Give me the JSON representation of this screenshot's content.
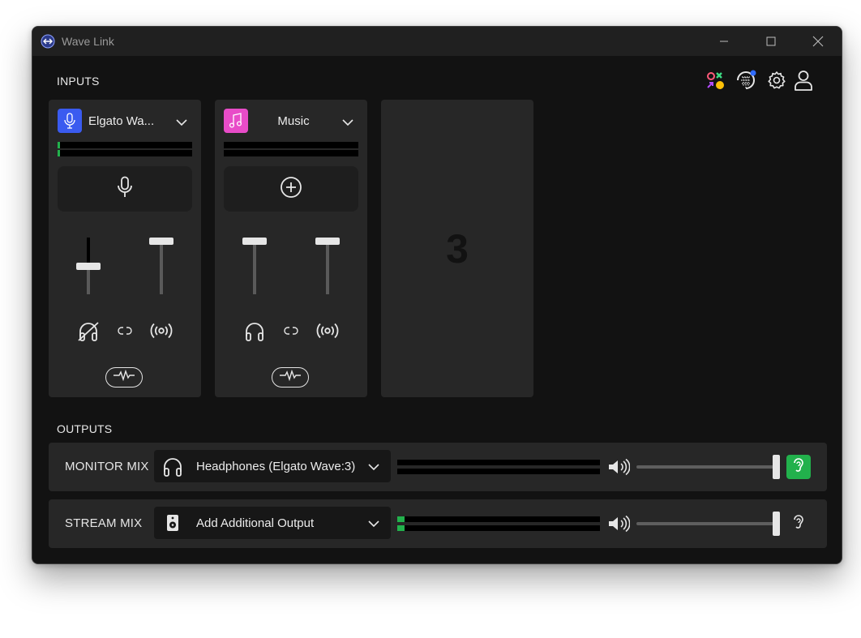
{
  "window": {
    "title": "Wave Link"
  },
  "inputs": {
    "label": "INPUTS",
    "channels": [
      {
        "name": "Elgato Wa...",
        "badge_color": "#3a5bf0",
        "icon": "microphone-icon",
        "action_icon": "microphone-icon",
        "monitor_fader_level": 0.5,
        "stream_fader_level": 1.0,
        "monitor_icon": "headphones-muted-icon",
        "stream_icon": "broadcast-icon",
        "link_icon": "link-icon",
        "fx_icon": "waveform-icon"
      },
      {
        "name": "Music",
        "badge_color": "#e84cc8",
        "icon": "music-note-icon",
        "action_icon": "add-circle-icon",
        "monitor_fader_level": 1.0,
        "stream_fader_level": 1.0,
        "monitor_icon": "headphones-icon",
        "stream_icon": "broadcast-icon",
        "link_icon": "link-icon",
        "fx_icon": "waveform-icon"
      }
    ],
    "empty_slot_number": "3"
  },
  "toolbar_icons": [
    "marketplace-icon",
    "update-icon",
    "settings-icon",
    "account-icon"
  ],
  "outputs": {
    "label": "OUTPUTS",
    "mixes": [
      {
        "label": "MONITOR MIX",
        "device": "Headphones (Elgato Wave:3)",
        "device_icon": "headphones-icon",
        "volume": 1.0,
        "listen_active": true
      },
      {
        "label": "STREAM MIX",
        "device": "Add Additional Output",
        "device_icon": "speaker-icon",
        "volume": 1.0,
        "listen_active": false
      }
    ]
  },
  "colors": {
    "accent_green": "#22b14c",
    "mic_badge": "#3a5bf0",
    "music_badge": "#e84cc8"
  }
}
